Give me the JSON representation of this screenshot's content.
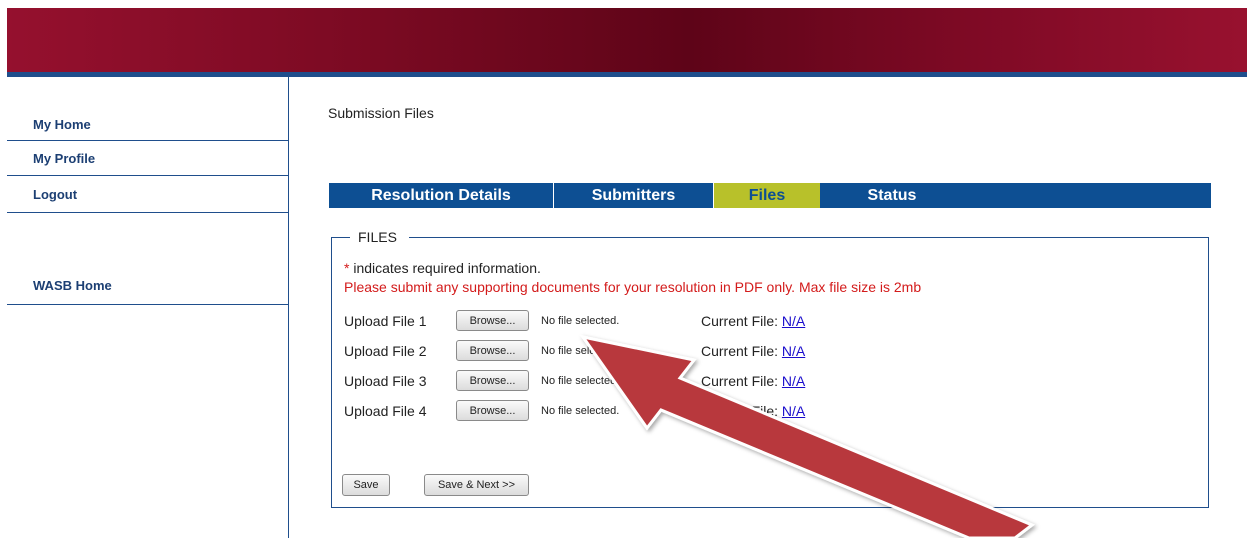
{
  "sidebar": {
    "items": [
      {
        "label": "My Home"
      },
      {
        "label": "My Profile"
      },
      {
        "label": "Logout"
      },
      {
        "label": "WASB Home"
      }
    ]
  },
  "main": {
    "title": "Submission Files",
    "tabs": [
      {
        "label": "Resolution Details",
        "active": false
      },
      {
        "label": "Submitters",
        "active": false
      },
      {
        "label": "Files",
        "active": true
      },
      {
        "label": "Status",
        "active": false
      }
    ],
    "fieldset": {
      "legend": "FILES",
      "required_star": "*",
      "required_text": " indicates required information.",
      "warning": "Please submit any supporting documents for your resolution in PDF only. Max file size is 2mb",
      "uploads": [
        {
          "label": "Upload File 1",
          "browse": "Browse...",
          "status": "No file selected.",
          "current_label": "Current File:",
          "current_value": "N/A"
        },
        {
          "label": "Upload File 2",
          "browse": "Browse...",
          "status": "No file selected.",
          "current_label": "Current File:",
          "current_value": "N/A"
        },
        {
          "label": "Upload File 3",
          "browse": "Browse...",
          "status": "No file selected.",
          "current_label": "Current File:",
          "current_value": "N/A"
        },
        {
          "label": "Upload File 4",
          "browse": "Browse...",
          "status": "No file selected.",
          "current_label": "Current File:",
          "current_value": "N/A"
        }
      ],
      "save_label": "Save",
      "save_next_label": "Save & Next >>"
    }
  },
  "colors": {
    "header_red": "#7a0a22",
    "nav_blue": "#0d4f93",
    "active_tab": "#b8c12a",
    "warning_red": "#d31b1b",
    "link_blue": "#1a0dcc",
    "arrow_red": "#b8383c"
  },
  "annotation": {
    "icon": "red-arrow-icon"
  }
}
